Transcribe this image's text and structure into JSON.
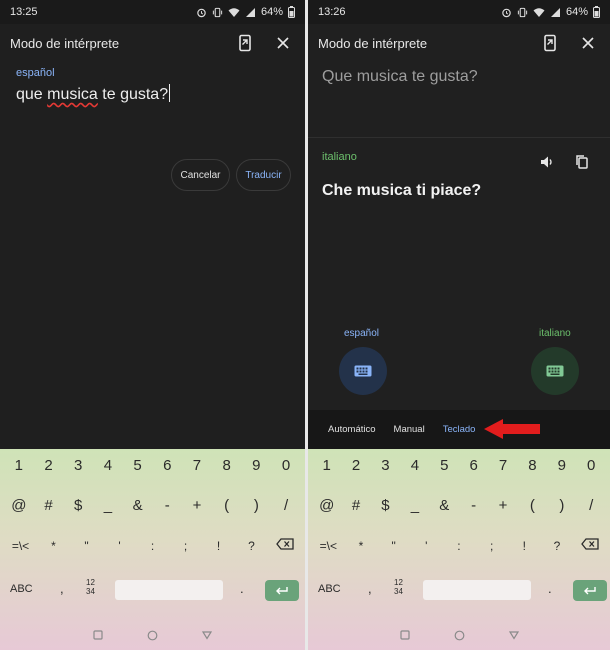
{
  "left": {
    "status": {
      "time": "13:25",
      "battery": "64%"
    },
    "app_title": "Modo de intérprete",
    "source_lang": "español",
    "input_text": {
      "part1": "que ",
      "misspelled": "musica",
      "part2": " te gusta?"
    },
    "cancel_label": "Cancelar",
    "translate_label": "Traducir"
  },
  "right": {
    "status": {
      "time": "13:26",
      "battery": "64%"
    },
    "app_title": "Modo de intérprete",
    "source_text": "Que musica te gusta?",
    "target_lang": "italiano",
    "target_text": "Che musica ti piace?",
    "lang_left": "español",
    "lang_right": "italiano",
    "modes": {
      "auto": "Automático",
      "manual": "Manual",
      "keyboard": "Teclado"
    }
  },
  "keyboard": {
    "row1": [
      "1",
      "2",
      "3",
      "4",
      "5",
      "6",
      "7",
      "8",
      "9",
      "0"
    ],
    "row2": [
      "@",
      "#",
      "$",
      "_",
      "&",
      "-",
      "+",
      "(",
      ")",
      "/"
    ],
    "row3": [
      "=\\<",
      "*",
      "\"",
      "'",
      ":",
      ";",
      "!",
      "?"
    ],
    "abc_label": "ABC",
    "comma": ",",
    "nums_top": "12",
    "nums_bottom": "34",
    "period": "."
  },
  "colors": {
    "accent_blue": "#8ab4f8",
    "accent_green": "#6cbf6c",
    "arrow_red": "#e21d1d",
    "spell_error": "#e53935"
  },
  "icons": [
    "alarm-icon",
    "vibrate-icon",
    "wifi-icon",
    "signal-icon",
    "battery-icon",
    "screen-switch-icon",
    "close-icon",
    "speaker-icon",
    "copy-icon",
    "keyboard-icon",
    "backspace-icon",
    "enter-icon",
    "nav-back-icon",
    "nav-home-icon",
    "nav-recents-icon"
  ]
}
